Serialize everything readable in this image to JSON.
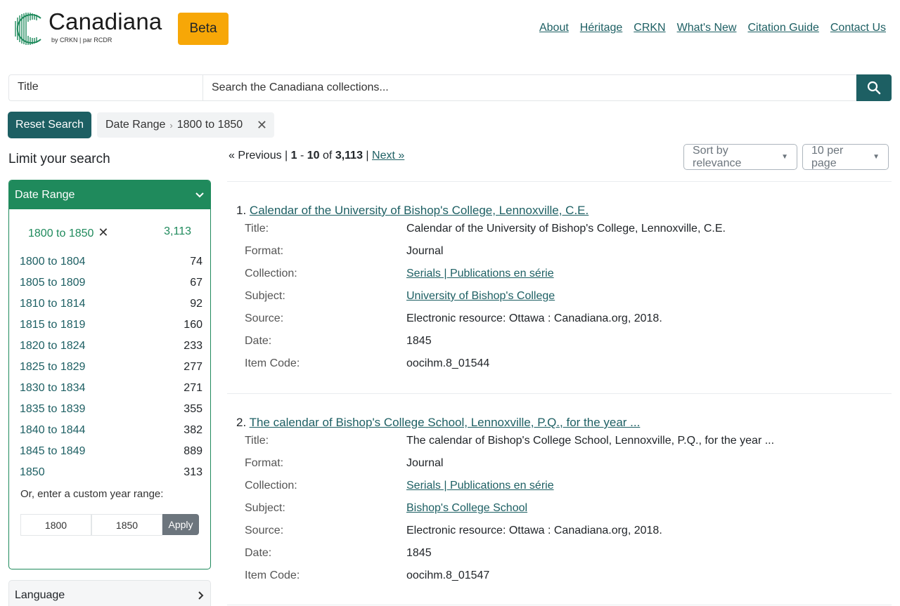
{
  "header": {
    "logo_text": "Canadiana",
    "logo_sub": "by CRKN | par RCDR",
    "beta": "Beta",
    "nav": [
      "About",
      "Héritage",
      "CRKN",
      "What's New",
      "Citation Guide",
      "Contact Us"
    ]
  },
  "search": {
    "field": "Title",
    "placeholder": "Search the Canadiana collections..."
  },
  "filters": {
    "reset": "Reset Search",
    "chip_name": "Date Range",
    "chip_value": "1800 to 1850"
  },
  "sidebar": {
    "title": "Limit your search",
    "date_facet": {
      "heading": "Date Range",
      "selected_label": "1800 to 1850",
      "selected_count": "3,113",
      "items": [
        {
          "label": "1800 to 1804",
          "count": "74"
        },
        {
          "label": "1805 to 1809",
          "count": "67"
        },
        {
          "label": "1810 to 1814",
          "count": "92"
        },
        {
          "label": "1815 to 1819",
          "count": "160"
        },
        {
          "label": "1820 to 1824",
          "count": "233"
        },
        {
          "label": "1825 to 1829",
          "count": "277"
        },
        {
          "label": "1830 to 1834",
          "count": "271"
        },
        {
          "label": "1835 to 1839",
          "count": "355"
        },
        {
          "label": "1840 to 1844",
          "count": "382"
        },
        {
          "label": "1845 to 1849",
          "count": "889"
        },
        {
          "label": "1850",
          "count": "313"
        }
      ],
      "custom_label": "Or, enter a custom year range:",
      "custom_from": "1800",
      "custom_to": "1850",
      "apply": "Apply"
    },
    "language_facet": "Language"
  },
  "pager": {
    "previous": "« Previous",
    "range_start": "1",
    "range_end": "10",
    "of": "of",
    "total": "3,113",
    "next": "Next »"
  },
  "sort": {
    "relevance": "Sort by relevance",
    "per_page": "10 per page"
  },
  "results": [
    {
      "number": "1.",
      "title": "Calendar of the University of Bishop's College, Lennoxville, C.E.",
      "fields": [
        {
          "k": "Title:",
          "v": "Calendar of the University of Bishop's College, Lennoxville, C.E.",
          "link": false
        },
        {
          "k": "Format:",
          "v": "Journal",
          "link": false
        },
        {
          "k": "Collection:",
          "v": "Serials | Publications en série",
          "link": true
        },
        {
          "k": "Subject:",
          "v": "University of Bishop's College",
          "link": true
        },
        {
          "k": "Source:",
          "v": "Electronic resource: Ottawa : Canadiana.org, 2018.",
          "link": false
        },
        {
          "k": "Date:",
          "v": "1845",
          "link": false
        },
        {
          "k": "Item Code:",
          "v": "oocihm.8_01544",
          "link": false
        }
      ]
    },
    {
      "number": "2.",
      "title": "The calendar of Bishop's College School, Lennoxville, P.Q., for the year ...",
      "fields": [
        {
          "k": "Title:",
          "v": "The calendar of Bishop's College School, Lennoxville, P.Q., for the year ...",
          "link": false
        },
        {
          "k": "Format:",
          "v": "Journal",
          "link": false
        },
        {
          "k": "Collection:",
          "v": "Serials | Publications en série",
          "link": true
        },
        {
          "k": "Subject:",
          "v": "Bishop's College School",
          "link": true
        },
        {
          "k": "Source:",
          "v": "Electronic resource: Ottawa : Canadiana.org, 2018.",
          "link": false
        },
        {
          "k": "Date:",
          "v": "1845",
          "link": false
        },
        {
          "k": "Item Code:",
          "v": "oocihm.8_01547",
          "link": false
        }
      ]
    }
  ]
}
